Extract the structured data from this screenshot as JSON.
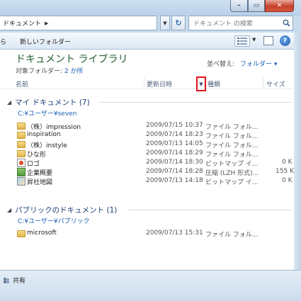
{
  "address": {
    "path": "ドキュメント",
    "search_placeholder": "ドキュメント の検索"
  },
  "toolbar": {
    "back_label": "ら",
    "new_folder_label": "新しいフォルダー"
  },
  "library": {
    "title": "ドキュメント ライブラリ",
    "subtitle_prefix": "対象フォルダー: ",
    "subtitle_link": "2 か所",
    "arrange_label": "並べ替え:",
    "arrange_value": "フォルダー ▾"
  },
  "columns": {
    "name": "名前",
    "date": "更新日時",
    "type": "種類",
    "size": "サイズ"
  },
  "groups": [
    {
      "header": "マイ ドキュメント (7)",
      "path": "C:¥ユーザー¥seven",
      "items": [
        {
          "icon": "folder-icon",
          "name": "（株）impression",
          "date": "2009/07/15 10:37",
          "type": "ファイル フォル...",
          "size": ""
        },
        {
          "icon": "folder-icon",
          "name": "inspiration",
          "date": "2009/07/14 18:23",
          "type": "ファイル フォル...",
          "size": ""
        },
        {
          "icon": "folder-icon",
          "name": "（株）instyle",
          "date": "2009/07/13 14:05",
          "type": "ファイル フォル...",
          "size": ""
        },
        {
          "icon": "folder-icon",
          "name": "ひな形",
          "date": "2009/07/14 18:29",
          "type": "ファイル フォル...",
          "size": ""
        },
        {
          "icon": "image-icon",
          "name": "ロゴ",
          "date": "2009/07/14 18:30",
          "type": "ビットマップ イ...",
          "size": "0 K"
        },
        {
          "icon": "zip-icon",
          "name": "企業概要",
          "date": "2009/07/14 18:28",
          "type": "圧縮 (LZH 形式)...",
          "size": "155 K"
        },
        {
          "icon": "map-icon",
          "name": "昇社地図",
          "date": "2009/07/13 14:18",
          "type": "ビットマップ イ...",
          "size": "0 K"
        }
      ]
    },
    {
      "header": "パブリックのドキュメント (1)",
      "path": "C:¥ユーザー¥パブリック",
      "items": [
        {
          "icon": "folder-icon",
          "name": "microsoft",
          "date": "2009/07/13 15:31",
          "type": "ファイル フォル...",
          "size": ""
        }
      ]
    }
  ],
  "status": {
    "share_label": "共有"
  }
}
